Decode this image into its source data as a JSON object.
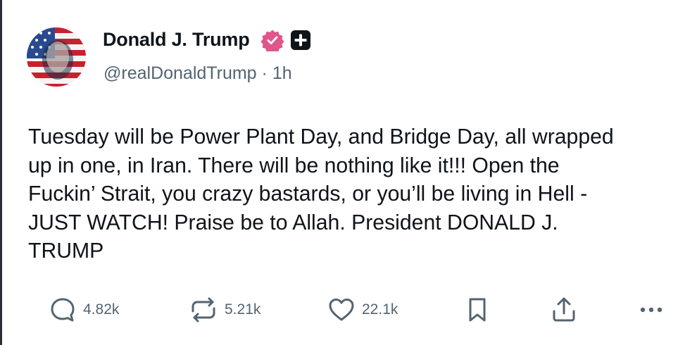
{
  "author": {
    "display_name": "Donald J. Trump",
    "handle": "@realDonaldTrump",
    "separator": "·",
    "timestamp": "1h",
    "verified_color": "#e0558b",
    "plus_badge_color": "#0f1419"
  },
  "post": {
    "text": "Tuesday will be Power Plant Day, and Bridge Day, all wrapped\nup in one, in Iran. There will be nothing like it!!! Open the\nFuckin’ Strait, you crazy bastards, or you’ll be living in Hell -\nJUST WATCH! Praise be to Allah. President DONALD J.\nTRUMP"
  },
  "actions": {
    "reply": {
      "icon": "reply-icon",
      "count": "4.82k"
    },
    "repost": {
      "icon": "repost-icon",
      "count": "5.21k"
    },
    "like": {
      "icon": "heart-icon",
      "count": "22.1k"
    },
    "bookmark": {
      "icon": "bookmark-icon"
    },
    "share": {
      "icon": "share-icon"
    },
    "more": {
      "icon": "more-icon"
    }
  }
}
